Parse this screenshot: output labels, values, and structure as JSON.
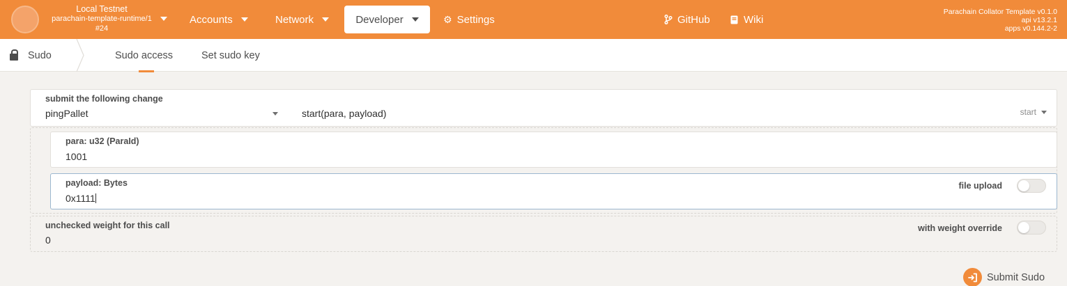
{
  "topbar": {
    "chain_name": "Local Testnet",
    "runtime": "parachain-template-runtime/1",
    "block": "#24",
    "menu": {
      "accounts": "Accounts",
      "network": "Network",
      "developer": "Developer",
      "settings": "Settings",
      "github": "GitHub",
      "wiki": "Wiki"
    },
    "version": {
      "line1": "Parachain Collator Template v0.1.0",
      "line2": "api v13.2.1",
      "line3": "apps v0.144.2-2"
    },
    "accent": "#f18b3a"
  },
  "subnav": {
    "section": "Sudo",
    "tabs": [
      "Sudo access",
      "Set sudo key"
    ],
    "active_tab": "Sudo access"
  },
  "form": {
    "change_label": "submit the following change",
    "pallet": "pingPallet",
    "call": "start(para, payload)",
    "call_name": "start",
    "para_label": "para: u32 (ParaId)",
    "para_value": "1001",
    "payload_label": "payload: Bytes",
    "payload_value": "0x1111",
    "file_upload_label": "file upload",
    "weight_label": "unchecked weight for this call",
    "weight_value": "0",
    "weight_override_label": "with weight override",
    "submit_label": "Submit Sudo"
  }
}
